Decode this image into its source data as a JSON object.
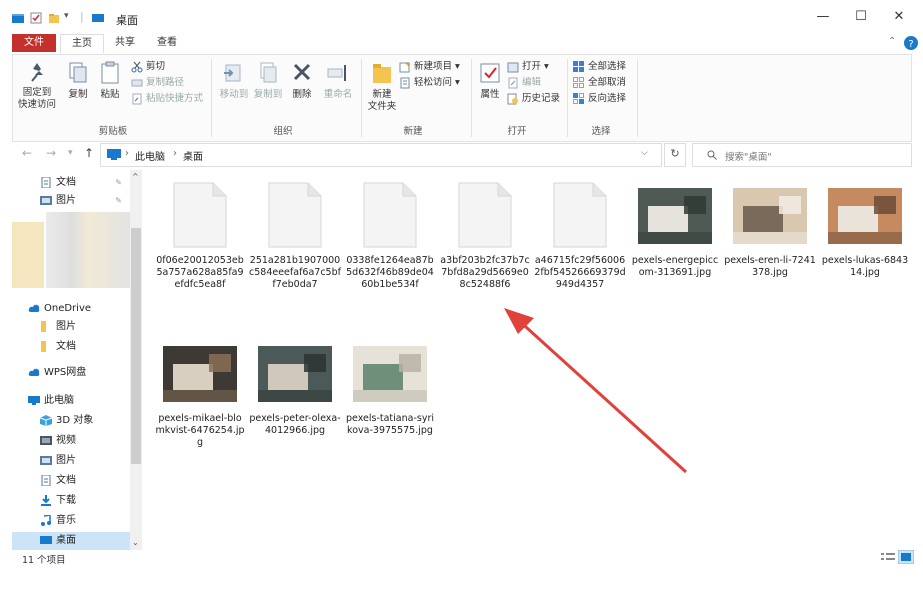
{
  "window": {
    "title": "桌面",
    "controls": {
      "minimize": "—",
      "maximize": "☐",
      "close": "✕"
    }
  },
  "ribbon": {
    "tabs": [
      "文件",
      "主页",
      "共享",
      "查看"
    ],
    "clipboard": {
      "pin_label": "固定到\n快速访问",
      "copy_label": "复制",
      "paste_label": "粘贴",
      "cut_label": "剪切",
      "copy_path_label": "复制路径",
      "paste_shortcut_label": "粘贴快捷方式",
      "group": "剪贴板"
    },
    "organize": {
      "move_to_label": "移动到",
      "copy_to_label": "复制到",
      "delete_label": "删除",
      "rename_label": "重命名",
      "group": "组织"
    },
    "new": {
      "new_folder_label": "新建\n文件夹",
      "new_item_label": "新建项目 ▾",
      "easy_access_label": "轻松访问 ▾",
      "group": "新建"
    },
    "open": {
      "properties_label": "属性",
      "open_label": "打开 ▾",
      "edit_label": "编辑",
      "history_label": "历史记录",
      "group": "打开"
    },
    "select": {
      "select_all_label": "全部选择",
      "select_none_label": "全部取消",
      "invert_label": "反向选择",
      "group": "选择"
    },
    "help_up": "⌃"
  },
  "address": {
    "crumbs": [
      "此电脑",
      "桌面"
    ],
    "search_placeholder": "搜索\"桌面\""
  },
  "sidebar": {
    "items": [
      {
        "label": "文档",
        "icon": "document-icon",
        "pinned": true
      },
      {
        "label": "图片",
        "icon": "pictures-icon",
        "pinned": true
      },
      {
        "label": "OneDrive",
        "icon": "cloud-icon",
        "top": true
      },
      {
        "label": "图片",
        "icon": "folder-icon"
      },
      {
        "label": "文档",
        "icon": "folder-icon"
      },
      {
        "label": "WPS网盘",
        "icon": "cloud-icon",
        "top": true
      },
      {
        "label": "此电脑",
        "icon": "computer-icon",
        "top": true
      },
      {
        "label": "3D 对象",
        "icon": "cube-icon"
      },
      {
        "label": "视频",
        "icon": "video-icon"
      },
      {
        "label": "图片",
        "icon": "pictures-icon"
      },
      {
        "label": "文档",
        "icon": "document-icon"
      },
      {
        "label": "下载",
        "icon": "download-icon"
      },
      {
        "label": "音乐",
        "icon": "music-icon"
      },
      {
        "label": "桌面",
        "icon": "desktop-icon",
        "selected": true
      }
    ]
  },
  "files": [
    {
      "name": "0f06e20012053eb5a757a628a85fa9efdfc5ea8f",
      "kind": "blank"
    },
    {
      "name": "251a281b1907000c584eeefaf6a7c5bff7eb0da7",
      "kind": "blank"
    },
    {
      "name": "0338fe1264ea87b5d632f46b89de0460b1be534f",
      "kind": "blank"
    },
    {
      "name": "a3bf203b2fc37b7c7bfd8a29d5669e08c52488f6",
      "kind": "blank"
    },
    {
      "name": "a46715fc29f560062fbf54526669379d949d4357",
      "kind": "blank"
    },
    {
      "name": "pexels-energepiccom-313691.jpg",
      "kind": "photo",
      "palette": [
        "#4f5a55",
        "#e6e3dc",
        "#2f3a35"
      ]
    },
    {
      "name": "pexels-eren-li-7241378.jpg",
      "kind": "photo",
      "palette": [
        "#d9c7b0",
        "#7a6a5a",
        "#f2ece4"
      ]
    },
    {
      "name": "pexels-lukas-684314.jpg",
      "kind": "photo",
      "palette": [
        "#c68a60",
        "#e9e3da",
        "#6b4b3a"
      ]
    },
    {
      "name": "pexels-mikael-blomkvist-6476254.jpg",
      "kind": "photo",
      "palette": [
        "#3d3a35",
        "#d8cfc0",
        "#8a6f55"
      ]
    },
    {
      "name": "pexels-peter-olexa-4012966.jpg",
      "kind": "photo",
      "palette": [
        "#4b5a58",
        "#cfc8bb",
        "#2d3433"
      ]
    },
    {
      "name": "pexels-tatiana-syrikova-3975575.jpg",
      "kind": "photo",
      "palette": [
        "#e6e2d8",
        "#6f8f7a",
        "#b9b3a6"
      ]
    }
  ],
  "status": {
    "count_label": "11 个项目"
  },
  "colors": {
    "file_tab": "#c4302b",
    "accent": "#1979ca",
    "arrow": "#e0413a",
    "selected": "#cce4f7"
  }
}
